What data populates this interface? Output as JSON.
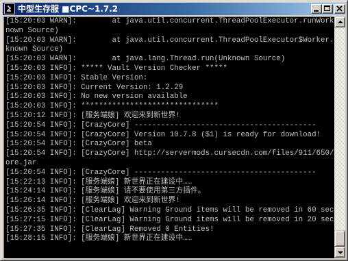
{
  "window": {
    "title": "中型生存服  ■CPC~1.7.2",
    "accent_color": "#0a246a",
    "console_bg": "#000000",
    "console_fg": "#c0c0c0"
  },
  "titlebar_buttons": [
    "minimize",
    "maximize",
    "close"
  ],
  "console": {
    "lines": [
      "[15:20:03 WARN]:        at java.util.concurrent.ThreadPoolExecutor.runWorker(Unk",
      "nown Source)",
      "[15:20:03 WARN]:        at java.util.concurrent.ThreadPoolExecutor$Worker.run(Un",
      "known Source)",
      "[15:20:03 WARN]:        at java.lang.Thread.run(Unknown Source)",
      "[15:20:03 INFO]: ***** Vault Version Checker *****",
      "[15:20:03 INFO]: Stable Version:",
      "[15:20:03 INFO]: Current Version: 1.2.29",
      "[15:20:03 INFO]: No new version available",
      "[15:20:03 INFO]: *******************************",
      "[15:20:12 INFO]: [服务端娘] 欢迎来到新世界!",
      "[15:20:54 INFO]: [CrazyCore] -----------------------------------------",
      "[15:20:54 INFO]: [CrazyCore] Version 10.7.8 ($1) is ready for download!",
      "[15:20:54 INFO]: [CrazyCore] beta",
      "[15:20:54 INFO]: [CrazyCore] http://servermods.cursecdn.com/files/911/650/CrazyC",
      "ore.jar",
      "[15:20:54 INFO]: [CrazyCore] -----------------------------------------",
      "[15:22:13 INFO]: [服务端娘] 新世界正在建设中……",
      "[15:24:14 INFO]: [服务端娘] 请不要使用第三方插件。",
      "[15:26:14 INFO]: [服务端娘] 欢迎来到新世界!",
      "[15:26:35 INFO]: [ClearLag] Warning Ground items will be removed in 60 seconds!",
      "[15:27:15 INFO]: [ClearLag] Warning Ground items will be removed in 20 seconds!",
      "[15:27:35 INFO]: [ClearLag] Removed 0 Entities!",
      "[15:28:15 INFO]: [服务端娘] 新世界正在建设中……",
      ""
    ]
  },
  "scrollbar": {
    "position_fraction": 0.97
  }
}
